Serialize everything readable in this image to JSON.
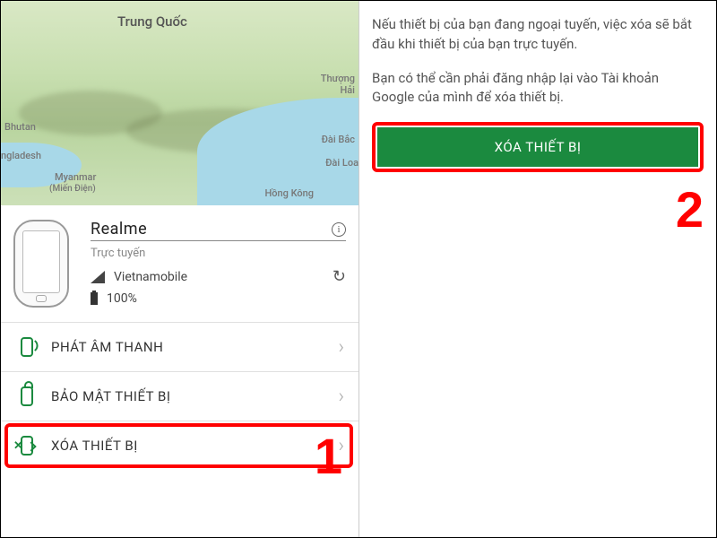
{
  "map": {
    "labels": {
      "china": "Trung Quốc",
      "bhutan": "Bhutan",
      "bangladesh": "ngladesh",
      "myanmar": "Myanmar",
      "mien_dien": "(Miến Điện)",
      "thuong_hai": "Thượng\nHải",
      "dai_bac": "Đài Bắc",
      "dai_loan": "Đài Loa",
      "hongkong": "Hồng Kông"
    }
  },
  "device": {
    "name": "Realme",
    "status": "Trực tuyến",
    "carrier": "Vietnamobile",
    "battery": "100%"
  },
  "actions": {
    "play_sound": "PHÁT ÂM THANH",
    "secure_device": "BẢO MẬT THIẾT BỊ",
    "erase_device": "XÓA THIẾT BỊ"
  },
  "right": {
    "paragraph1": "Nếu thiết bị của bạn đang ngoại tuyến, việc xóa sẽ bắt đầu khi thiết bị của bạn trực tuyến.",
    "paragraph2": "Bạn có thể cần phải đăng nhập lại vào Tài khoản Google của mình để xóa thiết bị.",
    "erase_button": "XÓA THIẾT BỊ"
  },
  "annotations": {
    "step1": "1",
    "step2": "2"
  }
}
